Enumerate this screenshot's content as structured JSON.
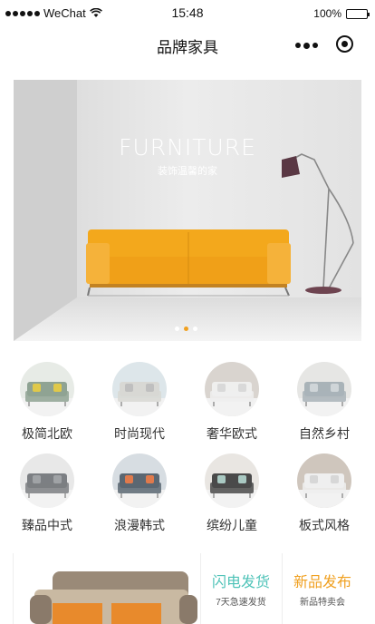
{
  "status": {
    "carrier": "WeChat",
    "time": "15:48",
    "battery": "100%",
    "battery_level": 1.0
  },
  "nav": {
    "title": "品牌家具"
  },
  "banner": {
    "title": "FURNITURE",
    "subtitle": "装饰温馨的家",
    "dots": 3,
    "active_dot": 1
  },
  "categories": [
    {
      "label": "极简北欧",
      "icon": "nordic-sofa-image"
    },
    {
      "label": "时尚现代",
      "icon": "modern-sofa-image"
    },
    {
      "label": "奢华欧式",
      "icon": "luxury-sofa-image"
    },
    {
      "label": "自然乡村",
      "icon": "rustic-sofa-image"
    },
    {
      "label": "臻品中式",
      "icon": "chinese-sofa-image"
    },
    {
      "label": "浪漫韩式",
      "icon": "korean-sofa-image"
    },
    {
      "label": "缤纷儿童",
      "icon": "kids-sofa-image"
    },
    {
      "label": "板式风格",
      "icon": "panel-sofa-image"
    }
  ],
  "promo": {
    "flash": {
      "title": "闪电发货",
      "subtitle": "7天急速发货"
    },
    "new": {
      "title": "新品发布",
      "subtitle": "新品特卖会"
    }
  },
  "colors": {
    "accent_orange": "#f0a020",
    "accent_teal": "#4fc3b8",
    "sofa_yellow": "#f3a81c"
  }
}
